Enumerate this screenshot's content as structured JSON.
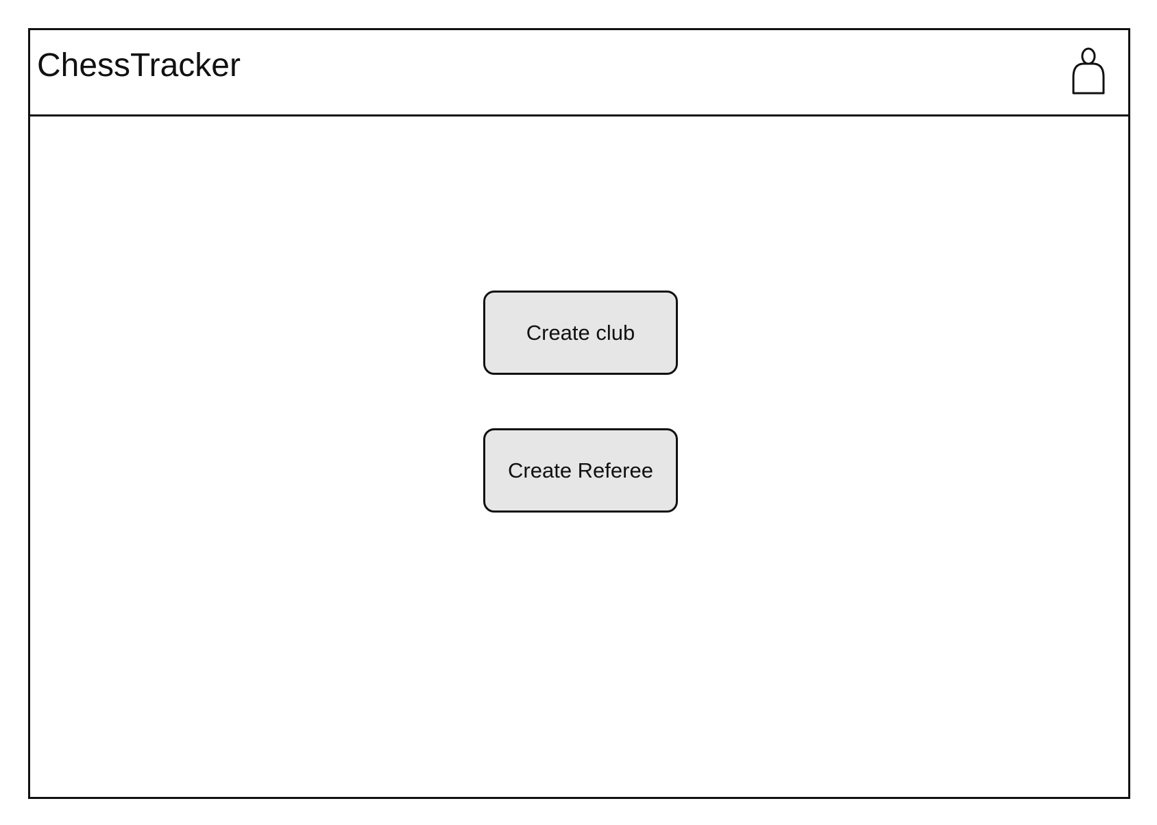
{
  "header": {
    "app_title": "ChessTracker",
    "user_icon": "user-icon"
  },
  "main": {
    "actions": {
      "create_club_label": "Create club",
      "create_referee_label": "Create Referee"
    }
  },
  "colors": {
    "border": "#111111",
    "button_fill": "#e6e6e6",
    "background": "#ffffff"
  }
}
